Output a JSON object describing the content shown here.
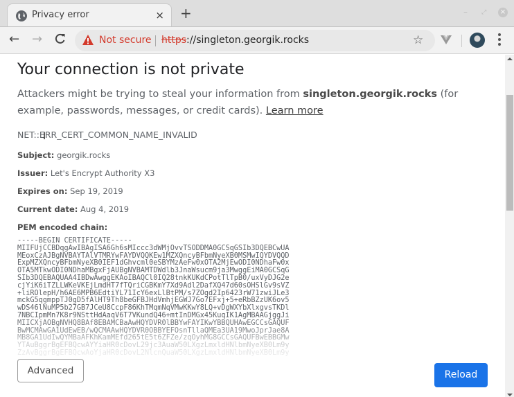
{
  "browser": {
    "tab": {
      "title": "Privacy error",
      "favicon": "globe-icon",
      "close_label": "×"
    },
    "new_tab_label": "+",
    "window_controls": {
      "minimize": "–",
      "maximize": "⤢",
      "close": "×"
    },
    "nav": {
      "back": "←",
      "forward": "→",
      "reload": "C"
    },
    "omnibox": {
      "security_label": "Not secure",
      "security_color": "#d33a2c",
      "url_scheme": "https",
      "url_rest": "://singleton.georgik.rocks"
    },
    "bookmark_icon": "☆"
  },
  "page": {
    "title": "Your connection is not private",
    "explain_prefix": "Attackers might be trying to steal your information from ",
    "explain_host": "singleton.georgik.rocks",
    "explain_suffix": " (for example, passwords, messages, or credit cards). ",
    "learn_more": "Learn more",
    "error_code": "NET::ERR_CERT_COMMON_NAME_INVALID",
    "details": [
      {
        "label": "Subject:",
        "value": " georgik.rocks"
      },
      {
        "label": "Issuer:",
        "value": " Let's Encrypt Authority X3"
      },
      {
        "label": "Expires on:",
        "value": " Sep 19, 2019"
      },
      {
        "label": "Current date:",
        "value": " Aug 4, 2019"
      },
      {
        "label": "PEM encoded chain:",
        "value": ""
      }
    ],
    "pem_lines": [
      "-----BEGIN CERTIFICATE-----",
      "MIIFUjCCBDqgAwIBAgISA6Gh6sMIccc3dWMjOvvTSODDMA0GCSqGSIb3DQEBCwUA",
      "MEoxCzAJBgNVBAYTAlVTMRYwFAYDVQQKEw1MZXQncyBFbmNyeXB0MSMwIQYDVQQD",
      "ExpMZXQncyBFbmNyeXB0IEF1dGhvcml0eSBYMzAeFw0xOTA2MjEwODI0NDhaFw0x",
      "OTA5MTkwODI0NDhaMBgxFjAUBgNVBAMTDWdlb3JnaWsucm9ja3MwggEiMA0GCSqG",
      "SIb3DQEBAQUAA4IBDwAwggEKAoIBAQCl0IQ28tnkKUKdCPotTlTpB0/uxVyDJG2e",
      "cjYiK6iTZLLWKeVKEjLmdHT7fTQriCGBKmY7Xd9Adl2DafXQ47d60sOHSlGv9sVZ",
      "+liROlepH/h6AE6MPB6EdtiYL71IcY6exLlBtPM/s7ZOgd2Ip6423rW71zwiJLe3",
      "mckG5qgmppTJ0gD5fAlHT9Th8beGFBJHdVmhjEGWJ7Go7EFxj+5+eRbBZzUK6ov5",
      "wDS46lNuMP5b27GB7JCeU8CcpF86KhTMqmNqVMwKKwY8LQ+vDgWXYbXlxgvsTKDl",
      "7NBCIpmMn7K8r9NSttHdAaqV6T7VKundQ46+mtInDMGx45KuqIK1AgMBAAGjggJi",
      "MIICXjAOBgNVHQ8BAf8EBAMCBaAwHQYDVR0lBBYwFAYIKwYBBQUHAwEGCCsGAQUF",
      "BwMCMAwGA1UdEwEB/wQCMAAwHQYDVR0OBBYEFOsnTllaQMEa3UA19MwoJprJae8A",
      "MB8GA1UdIwQYMBaAFKhKamMEfd265tE5t6ZFZe/zqOyhMG8GCCsGAQUFBwEBBGMw",
      "YTAuBggrBgEFBQcwAYYiaHR0cDovL29jc3AuaW50LXgzLmxldHNlbmNyeXB0Lm9y",
      "ZzAvBggrBgEFBQcwAoYjaHR0cDovL2NlcnQuaW50LXgzLmxldHNlbmNyeXB0Lm9y"
    ],
    "advanced_button": "Advanced",
    "reload_button": "Reload",
    "reload_color": "#1a73e8"
  }
}
